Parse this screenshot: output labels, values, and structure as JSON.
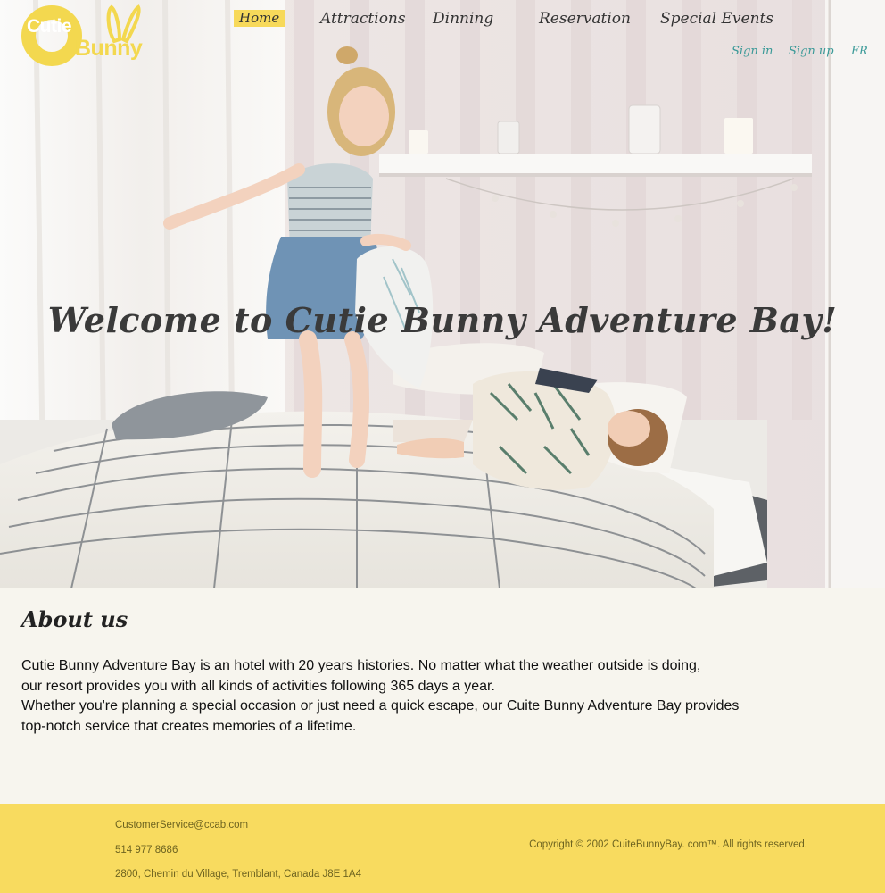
{
  "brand": {
    "logo_top": "Cutie",
    "logo_bottom": "Bunny",
    "logo_icon": "bunny-ears-icon",
    "color": "#f3d84f"
  },
  "nav": {
    "items": [
      {
        "label": "Home",
        "active": true
      },
      {
        "label": "Attractions",
        "active": false
      },
      {
        "label": "Dinning",
        "active": false
      },
      {
        "label": "Reservation",
        "active": false
      },
      {
        "label": "Special Events",
        "active": false
      }
    ],
    "active_color": "#f7d95a"
  },
  "account": {
    "sign_in": "Sign in",
    "sign_up": "Sign up",
    "language": "FR",
    "color": "#3b9a98"
  },
  "hero": {
    "heading": "Welcome to Cutie Bunny Adventure Bay!"
  },
  "about": {
    "title": "About us",
    "lines": [
      "Cutie Bunny Adventure Bay is an hotel with 20 years histories. No matter what the weather outside is doing,",
      "our resort provides you with all kinds of activities following 365 days a year.",
      "Whether you're planning a special occasion or just need a quick escape, our Cuite Bunny Adventure Bay provides",
      "top-notch service that creates memories of a lifetime."
    ]
  },
  "footer": {
    "email": "CustomerService@ccab.com",
    "phone": "514 977 8686",
    "address": "2800, Chemin du Village, Tremblant, Canada J8E 1A4",
    "copyright": "Copyright © 2002 CuiteBunnyBay. com™. All rights reserved.",
    "background": "#f8db5f"
  }
}
